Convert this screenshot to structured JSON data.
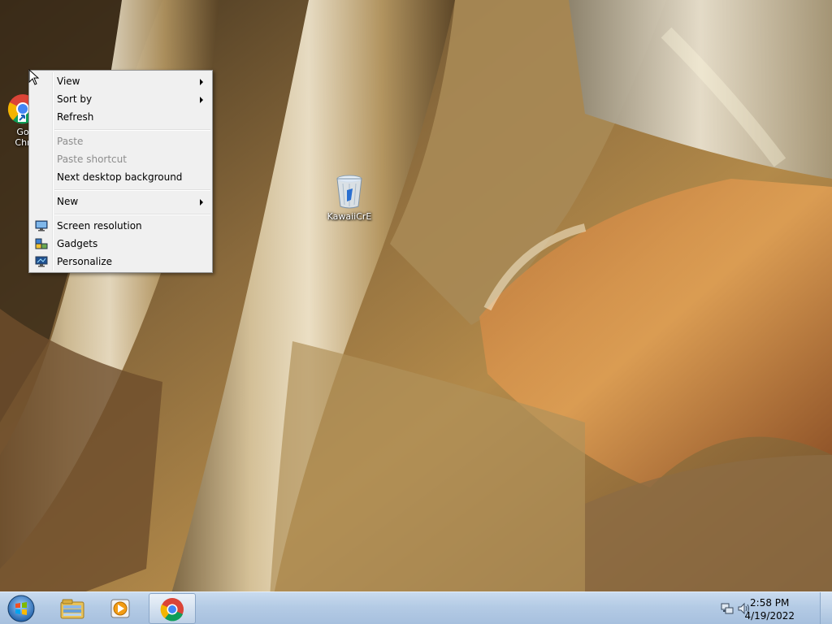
{
  "desktop": {
    "icons": [
      {
        "label_line1": "Go",
        "label_line2": "Chr",
        "icon": "chrome-icon"
      },
      {
        "label": "KawaiiCrE",
        "icon": "recycle-bin-icon"
      }
    ]
  },
  "context_menu": {
    "items": [
      {
        "label": "View",
        "submenu": true,
        "enabled": true
      },
      {
        "label": "Sort by",
        "submenu": true,
        "enabled": true
      },
      {
        "label": "Refresh",
        "enabled": true
      },
      {
        "label": "Paste",
        "enabled": false
      },
      {
        "label": "Paste shortcut",
        "enabled": false
      },
      {
        "label": "Next desktop background",
        "enabled": true
      },
      {
        "label": "New",
        "submenu": true,
        "enabled": true
      },
      {
        "label": "Screen resolution",
        "icon": "screen-resolution-icon",
        "enabled": true
      },
      {
        "label": "Gadgets",
        "icon": "gadgets-icon",
        "enabled": true
      },
      {
        "label": "Personalize",
        "icon": "personalize-icon",
        "enabled": true
      }
    ]
  },
  "taskbar": {
    "start_icon": "windows-start-orb-icon",
    "pinned": [
      {
        "icon": "windows-explorer-icon",
        "active": false
      },
      {
        "icon": "media-player-icon",
        "active": false
      },
      {
        "icon": "chrome-icon",
        "active": true
      }
    ],
    "tray_icons": [
      "network-icon",
      "volume-icon"
    ],
    "clock": {
      "time": "2:58 PM",
      "date": "4/19/2022"
    }
  }
}
